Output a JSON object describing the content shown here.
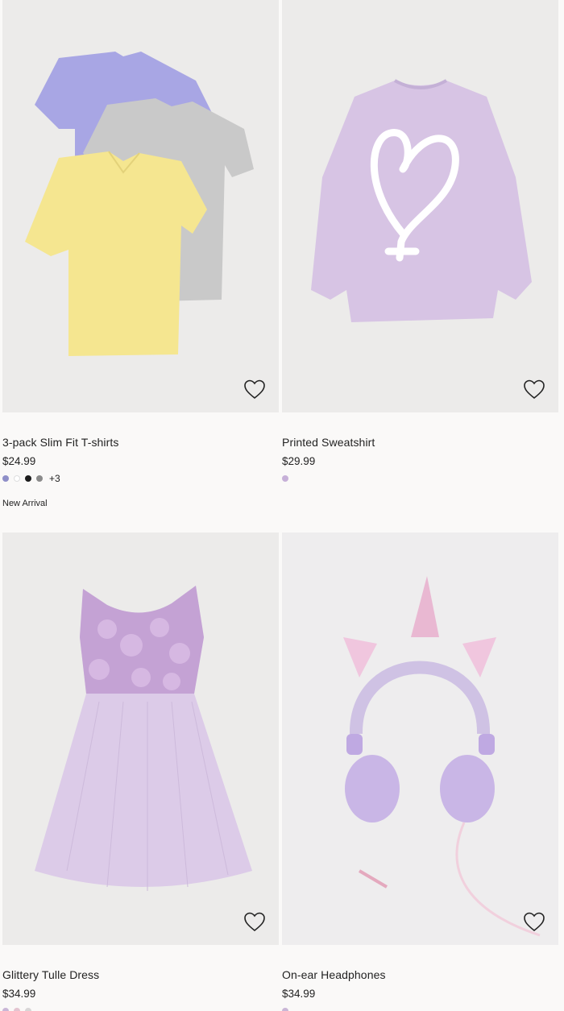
{
  "products": [
    {
      "title": "3-pack Slim Fit T-shirts",
      "price": "$24.99",
      "more_colors": "+3",
      "badge": "New Arrival",
      "swatches": [
        "#8f8fc8",
        "#ffffff",
        "#1c1c1c",
        "#8a8a8a"
      ]
    },
    {
      "title": "Printed Sweatshirt",
      "price": "$29.99",
      "swatches": [
        "#c6b0d8"
      ]
    },
    {
      "title": "Glittery Tulle Dress",
      "price": "$34.99",
      "swatches": [
        "#c9b6d6",
        "#e3c4d0",
        "#d8d6d6"
      ]
    },
    {
      "title": "On-ear Headphones",
      "price": "$34.99",
      "swatches": [
        "#c9b6d6"
      ]
    }
  ]
}
